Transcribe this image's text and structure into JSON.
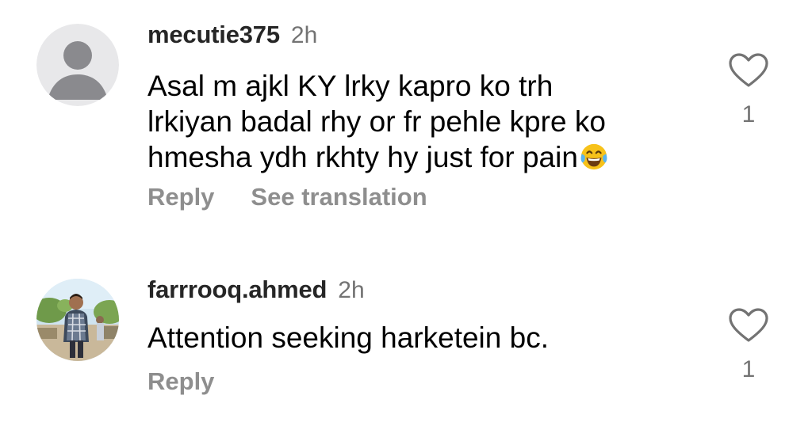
{
  "comments": [
    {
      "username": "mecutie375",
      "time": "2h",
      "text_lines": [
        "Asal m ajkl KY lrky kapro ko trh",
        "lrkiyan badal rhy or fr pehle kpre ko",
        "hmesha ydh rkhty hy just for pain"
      ],
      "emoji": "face-with-tears-of-joy",
      "actions": {
        "reply": "Reply",
        "translate": "See translation"
      },
      "like_count": "1",
      "avatar": "default-avatar-icon"
    },
    {
      "username": "farrrooq.ahmed",
      "time": "2h",
      "text_lines": [
        "Attention seeking harketein bc."
      ],
      "actions": {
        "reply": "Reply"
      },
      "like_count": "1",
      "avatar": "profile-photo"
    }
  ],
  "colors": {
    "username": "#262626",
    "secondary": "#737373",
    "action": "#8e8e8e",
    "avatar_bg": "#e8e8ea",
    "avatar_fg": "#8a8a8e"
  }
}
